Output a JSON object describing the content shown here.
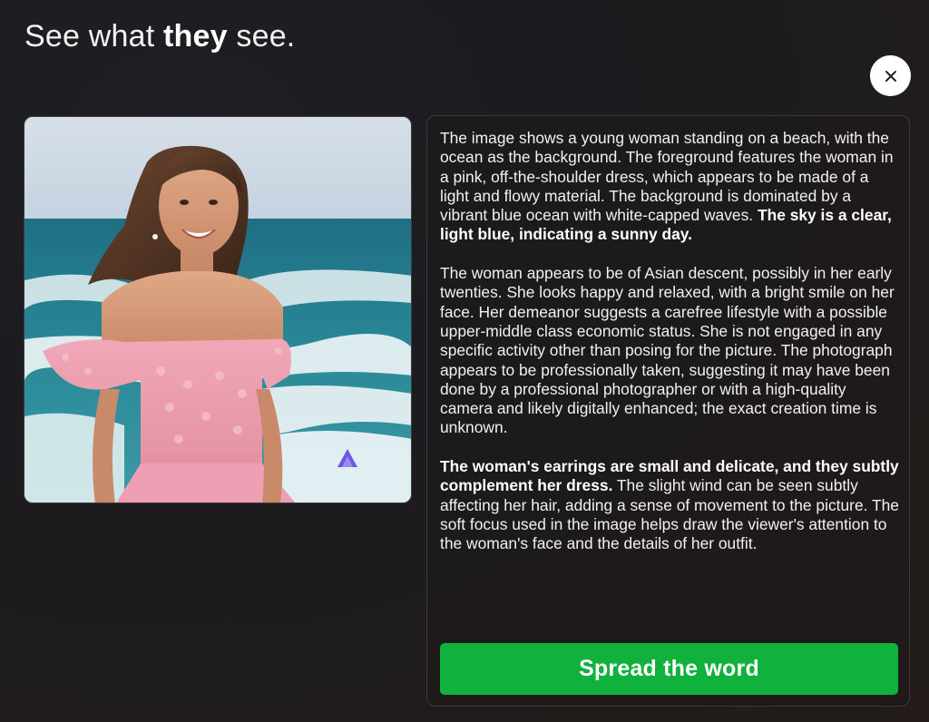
{
  "header": {
    "title_prefix": "See what ",
    "title_bold": "they",
    "title_suffix": " see."
  },
  "close_button": {
    "icon": "close-icon"
  },
  "photo": {
    "subject": "woman-on-beach-photo",
    "watermark_icon": "triangle-logo-icon"
  },
  "description": {
    "p1_text": "The image shows a young woman standing on a beach, with the ocean as the background. The foreground features the woman in a pink, off-the-shoulder dress, which appears to be made of a light and flowy material. The background is dominated by a vibrant blue ocean with white-capped waves. ",
    "p1_bold": "The sky is a clear, light blue, indicating a sunny day.",
    "p2_text": "The woman appears to be of Asian descent, possibly in her early twenties. She looks happy and relaxed, with a bright smile on her face. Her demeanor suggests a carefree lifestyle with a possible upper-middle class economic status. She is not engaged in any specific activity other than posing for the picture. The photograph appears to be professionally taken, suggesting it may have been done by a professional photographer or with a high-quality camera and likely digitally enhanced; the exact creation time is unknown.",
    "p3_bold": "The woman's earrings are small and delicate, and they subtly complement her dress.",
    "p3_text": " The slight wind can be seen subtly affecting her hair, adding a sense of movement to the picture. The soft focus used in the image helps draw the viewer's attention to the woman's face and the details of her outfit."
  },
  "cta": {
    "label": "Spread the word",
    "color": "#10b13c"
  }
}
